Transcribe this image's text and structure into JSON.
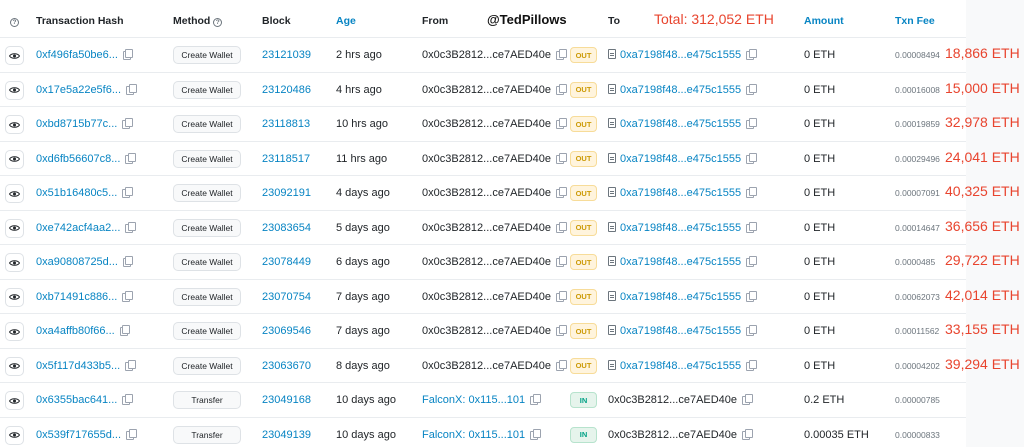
{
  "header": {
    "help_icon": "question-circle-icon",
    "hash": "Transaction Hash",
    "method": "Method",
    "block": "Block",
    "age": "Age",
    "from": "From",
    "handle": "@TedPillows",
    "to": "To",
    "total": "Total: 312,052 ETH",
    "amount": "Amount",
    "fee": "Txn Fee"
  },
  "colors": {
    "link": "#0784c3",
    "annotation": "#e8442e",
    "out_badge": "#cc9a06",
    "in_badge": "#00a186"
  },
  "rows": [
    {
      "hash": "0xf496fa50be6...",
      "method": "Create Wallet",
      "block": "23121039",
      "age": "2 hrs ago",
      "from": "0x0c3B2812...ce7AED40e",
      "dir": "OUT",
      "to": "0xa7198f48...e475c1555",
      "amount": "0 ETH",
      "fee": "0.00008494",
      "annot": "18,866 ETH"
    },
    {
      "hash": "0x17e5a22e5f6...",
      "method": "Create Wallet",
      "block": "23120486",
      "age": "4 hrs ago",
      "from": "0x0c3B2812...ce7AED40e",
      "dir": "OUT",
      "to": "0xa7198f48...e475c1555",
      "amount": "0 ETH",
      "fee": "0.00016008",
      "annot": "15,000 ETH"
    },
    {
      "hash": "0xbd8715b77c...",
      "method": "Create Wallet",
      "block": "23118813",
      "age": "10 hrs ago",
      "from": "0x0c3B2812...ce7AED40e",
      "dir": "OUT",
      "to": "0xa7198f48...e475c1555",
      "amount": "0 ETH",
      "fee": "0.00019859",
      "annot": "32,978 ETH"
    },
    {
      "hash": "0xd6fb56607c8...",
      "method": "Create Wallet",
      "block": "23118517",
      "age": "11 hrs ago",
      "from": "0x0c3B2812...ce7AED40e",
      "dir": "OUT",
      "to": "0xa7198f48...e475c1555",
      "amount": "0 ETH",
      "fee": "0.00029496",
      "annot": "24,041 ETH"
    },
    {
      "hash": "0x51b16480c5...",
      "method": "Create Wallet",
      "block": "23092191",
      "age": "4 days ago",
      "from": "0x0c3B2812...ce7AED40e",
      "dir": "OUT",
      "to": "0xa7198f48...e475c1555",
      "amount": "0 ETH",
      "fee": "0.00007091",
      "annot": "40,325 ETH"
    },
    {
      "hash": "0xe742acf4aa2...",
      "method": "Create Wallet",
      "block": "23083654",
      "age": "5 days ago",
      "from": "0x0c3B2812...ce7AED40e",
      "dir": "OUT",
      "to": "0xa7198f48...e475c1555",
      "amount": "0 ETH",
      "fee": "0.00014647",
      "annot": "36,656 ETH"
    },
    {
      "hash": "0xa90808725d...",
      "method": "Create Wallet",
      "block": "23078449",
      "age": "6 days ago",
      "from": "0x0c3B2812...ce7AED40e",
      "dir": "OUT",
      "to": "0xa7198f48...e475c1555",
      "amount": "0 ETH",
      "fee": "0.0000485",
      "annot": "29,722 ETH"
    },
    {
      "hash": "0xb71491c886...",
      "method": "Create Wallet",
      "block": "23070754",
      "age": "7 days ago",
      "from": "0x0c3B2812...ce7AED40e",
      "dir": "OUT",
      "to": "0xa7198f48...e475c1555",
      "amount": "0 ETH",
      "fee": "0.00062073",
      "annot": "42,014 ETH"
    },
    {
      "hash": "0xa4affb80f66...",
      "method": "Create Wallet",
      "block": "23069546",
      "age": "7 days ago",
      "from": "0x0c3B2812...ce7AED40e",
      "dir": "OUT",
      "to": "0xa7198f48...e475c1555",
      "amount": "0 ETH",
      "fee": "0.00011562",
      "annot": "33,155 ETH"
    },
    {
      "hash": "0x5f117d433b5...",
      "method": "Create Wallet",
      "block": "23063670",
      "age": "8 days ago",
      "from": "0x0c3B2812...ce7AED40e",
      "dir": "OUT",
      "to": "0xa7198f48...e475c1555",
      "amount": "0 ETH",
      "fee": "0.00004202",
      "annot": "39,294 ETH"
    },
    {
      "hash": "0x6355bac641...",
      "method": "Transfer",
      "block": "23049168",
      "age": "10 days ago",
      "from": "FalconX: 0x115...101",
      "dir": "IN",
      "to": "0x0c3B2812...ce7AED40e",
      "amount": "0.2 ETH",
      "fee": "0.00000785",
      "annot": ""
    },
    {
      "hash": "0x539f717655d...",
      "method": "Transfer",
      "block": "23049139",
      "age": "10 days ago",
      "from": "FalconX: 0x115...101",
      "dir": "IN",
      "to": "0x0c3B2812...ce7AED40e",
      "amount": "0.00035 ETH",
      "fee": "0.00000833",
      "annot": ""
    }
  ]
}
